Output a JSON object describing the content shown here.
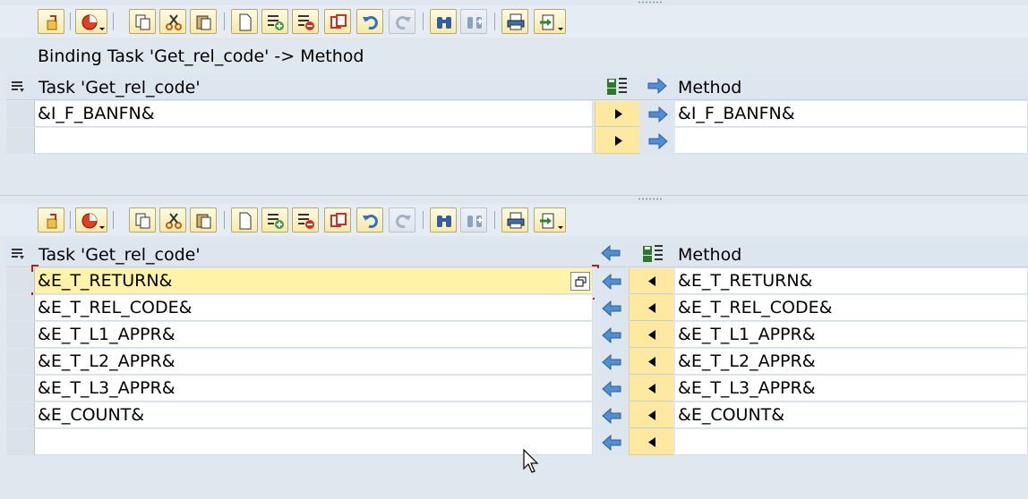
{
  "binding_title": "Binding Task 'Get_rel_code' -> Method",
  "upper": {
    "task_header": "Task 'Get_rel_code'",
    "method_header": "Method",
    "rows": [
      {
        "task": "&I_F_BANFN&",
        "method": "&I_F_BANFN&"
      },
      {
        "task": "",
        "method": ""
      }
    ]
  },
  "lower": {
    "task_header": "Task 'Get_rel_code'",
    "method_header": "Method",
    "rows": [
      {
        "task": "&E_T_RETURN&",
        "method": "&E_T_RETURN&"
      },
      {
        "task": "&E_T_REL_CODE&",
        "method": "&E_T_REL_CODE&"
      },
      {
        "task": "&E_T_L1_APPR&",
        "method": "&E_T_L1_APPR&"
      },
      {
        "task": "&E_T_L2_APPR&",
        "method": "&E_T_L2_APPR&"
      },
      {
        "task": "&E_T_L3_APPR&",
        "method": "&E_T_L3_APPR&"
      },
      {
        "task": "&E_COUNT&",
        "method": "&E_COUNT&"
      },
      {
        "task": "",
        "method": ""
      }
    ]
  },
  "toolbar_icons": [
    "details-icon",
    "undo-icon",
    "copy-icon",
    "cut-icon",
    "paste-icon",
    "new-icon",
    "insert-row-icon",
    "delete-row-icon",
    "copy-row-icon",
    "undo-icon",
    "redo-icon",
    "find-icon",
    "find-next-icon",
    "print-icon",
    "export-icon"
  ],
  "colors": {
    "background": "#dfe7ef",
    "button_yellow": "#ffe9a0",
    "highlight_row": "#fff3a8",
    "arrow_blue": "#4f8fd6"
  }
}
